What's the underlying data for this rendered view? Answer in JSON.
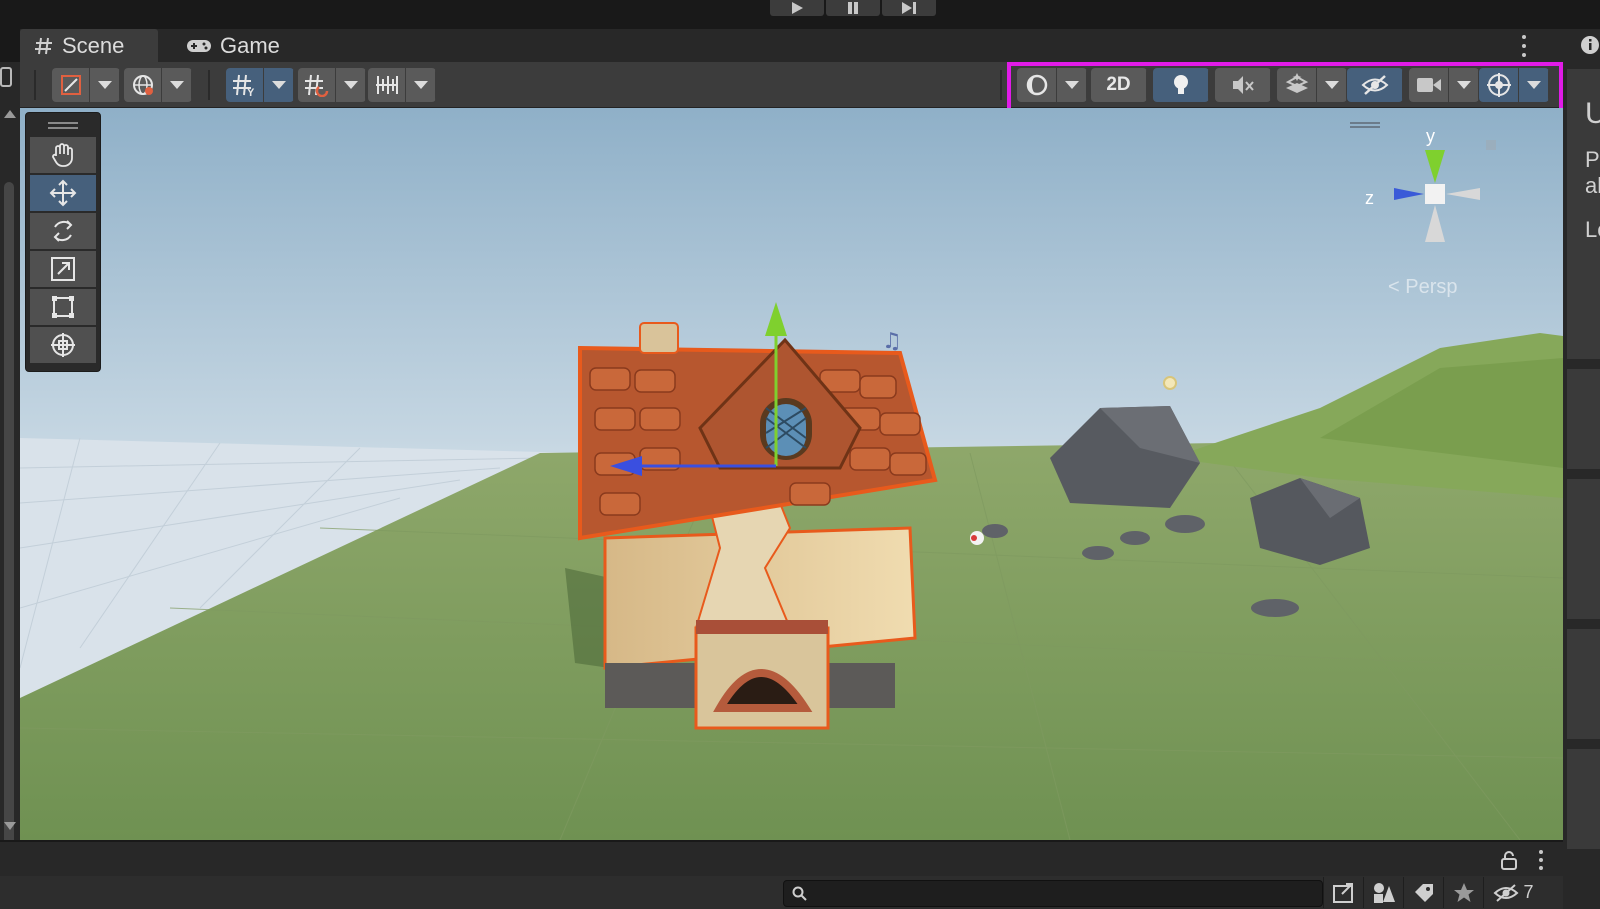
{
  "tabs": [
    {
      "label": "Scene",
      "icon": "hash-icon",
      "active": true
    },
    {
      "label": "Game",
      "icon": "gamepad-icon",
      "active": false
    }
  ],
  "scene_toolbar": {
    "toggle_2d_label": "2D",
    "highlight_color": "#e11be8",
    "active_color": "#46607c"
  },
  "transform_tools": [
    "hand-tool",
    "move-tool",
    "rotate-tool",
    "scale-tool",
    "rect-tool",
    "transform-tool"
  ],
  "active_tool": "move-tool",
  "orientation_gizmo": {
    "y_label": "y",
    "z_label": "z",
    "projection_label": "< Persp"
  },
  "right_panel": {
    "visible_text": [
      "U",
      "P",
      "al",
      "Lo"
    ]
  },
  "footer": {
    "search_placeholder": "",
    "hidden_count": "7"
  }
}
